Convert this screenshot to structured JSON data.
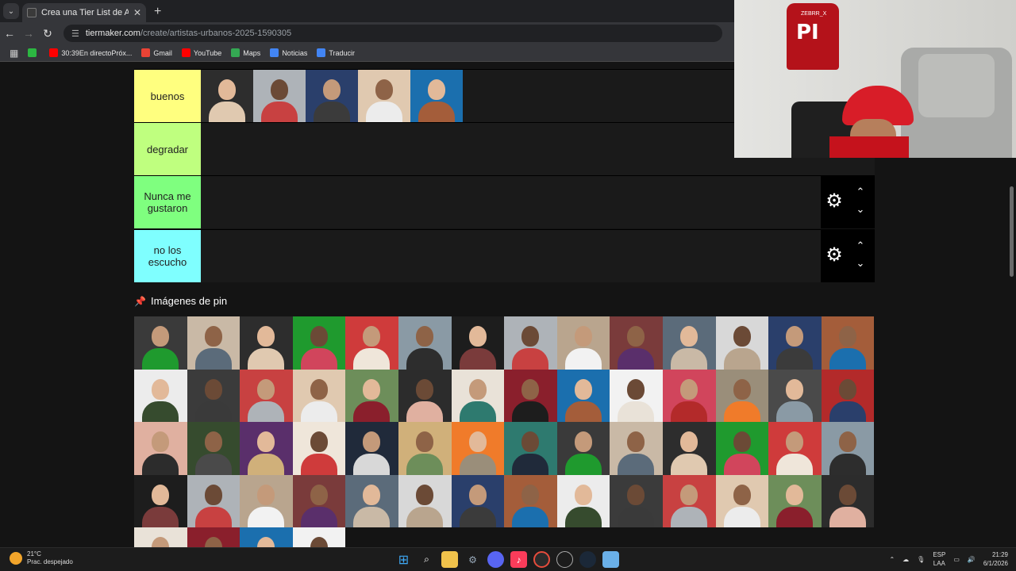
{
  "browser": {
    "tab_title": "Crea una Tier List de Artistas U",
    "tab_close": "✕",
    "new_tab": "+",
    "url_host": "tiermaker.com",
    "url_path": "/create/artistas-urbanos-2025-1590305",
    "nav": {
      "back": "←",
      "forward": "→",
      "reload": "↻",
      "menu": "⌄"
    },
    "bookmarks": [
      {
        "label": "",
        "color": "#2cb742",
        "icon": "whatsapp-icon"
      },
      {
        "label": "30:39En directoPróx...",
        "color": "#ff0000",
        "icon": "youtube-icon"
      },
      {
        "label": "Gmail",
        "color": "#ea4335",
        "icon": "gmail-icon"
      },
      {
        "label": "YouTube",
        "color": "#ff0000",
        "icon": "youtube-icon"
      },
      {
        "label": "Maps",
        "color": "#34a853",
        "icon": "maps-icon"
      },
      {
        "label": "Noticias",
        "color": "#4285f4",
        "icon": "news-icon"
      },
      {
        "label": "Traducir",
        "color": "#4285f4",
        "icon": "translate-icon"
      }
    ]
  },
  "tiers": [
    {
      "label": "buenos",
      "color": "#ffff7f",
      "items": 5
    },
    {
      "label": "degradar",
      "color": "#bfff7f",
      "items": 0
    },
    {
      "label": "Nunca me gustaron",
      "color": "#7fff7f",
      "items": 0
    },
    {
      "label": "no los escucho",
      "color": "#7fffff",
      "items": 0
    }
  ],
  "tier_controls": {
    "gear": "⚙",
    "up": "⌃",
    "down": "⌄"
  },
  "pin_section": {
    "icon": "📌",
    "title": "Imágenes de pin"
  },
  "thumb_palette": [
    "#3a3a3a",
    "#c9b9a6",
    "#2d2d2d",
    "#1f9a2e",
    "#cf3b3b",
    "#8a9aa5",
    "#1d1d1d",
    "#aeb3b8",
    "#b9a58e",
    "#7a3b3b",
    "#5b6b7a",
    "#d8d8d8",
    "#2a3f6b",
    "#a45d3a",
    "#ececec",
    "#3b3b3b",
    "#c84141",
    "#e0c9b0",
    "#6d8e5a",
    "#2c2c2c",
    "#e9e2d8",
    "#8a1f2c",
    "#1b6fae",
    "#f2f2f2",
    "#d1455c",
    "#9a8e7a",
    "#4a4a4a",
    "#b32a2a",
    "#e0b0a0",
    "#364b2e",
    "#5a2f6b",
    "#efe6da",
    "#202a3a",
    "#d0b07a",
    "#f07b2a",
    "#2e7a6f"
  ],
  "taskbar": {
    "temp": "21°C",
    "weather_desc": "Prac. despejado",
    "lang1": "ESP",
    "lang2": "LAA",
    "time": "21:29",
    "date": "6/1/2026"
  },
  "cam": {
    "jersey_number": "PI",
    "jersey_name": "ZEBRR_X"
  }
}
